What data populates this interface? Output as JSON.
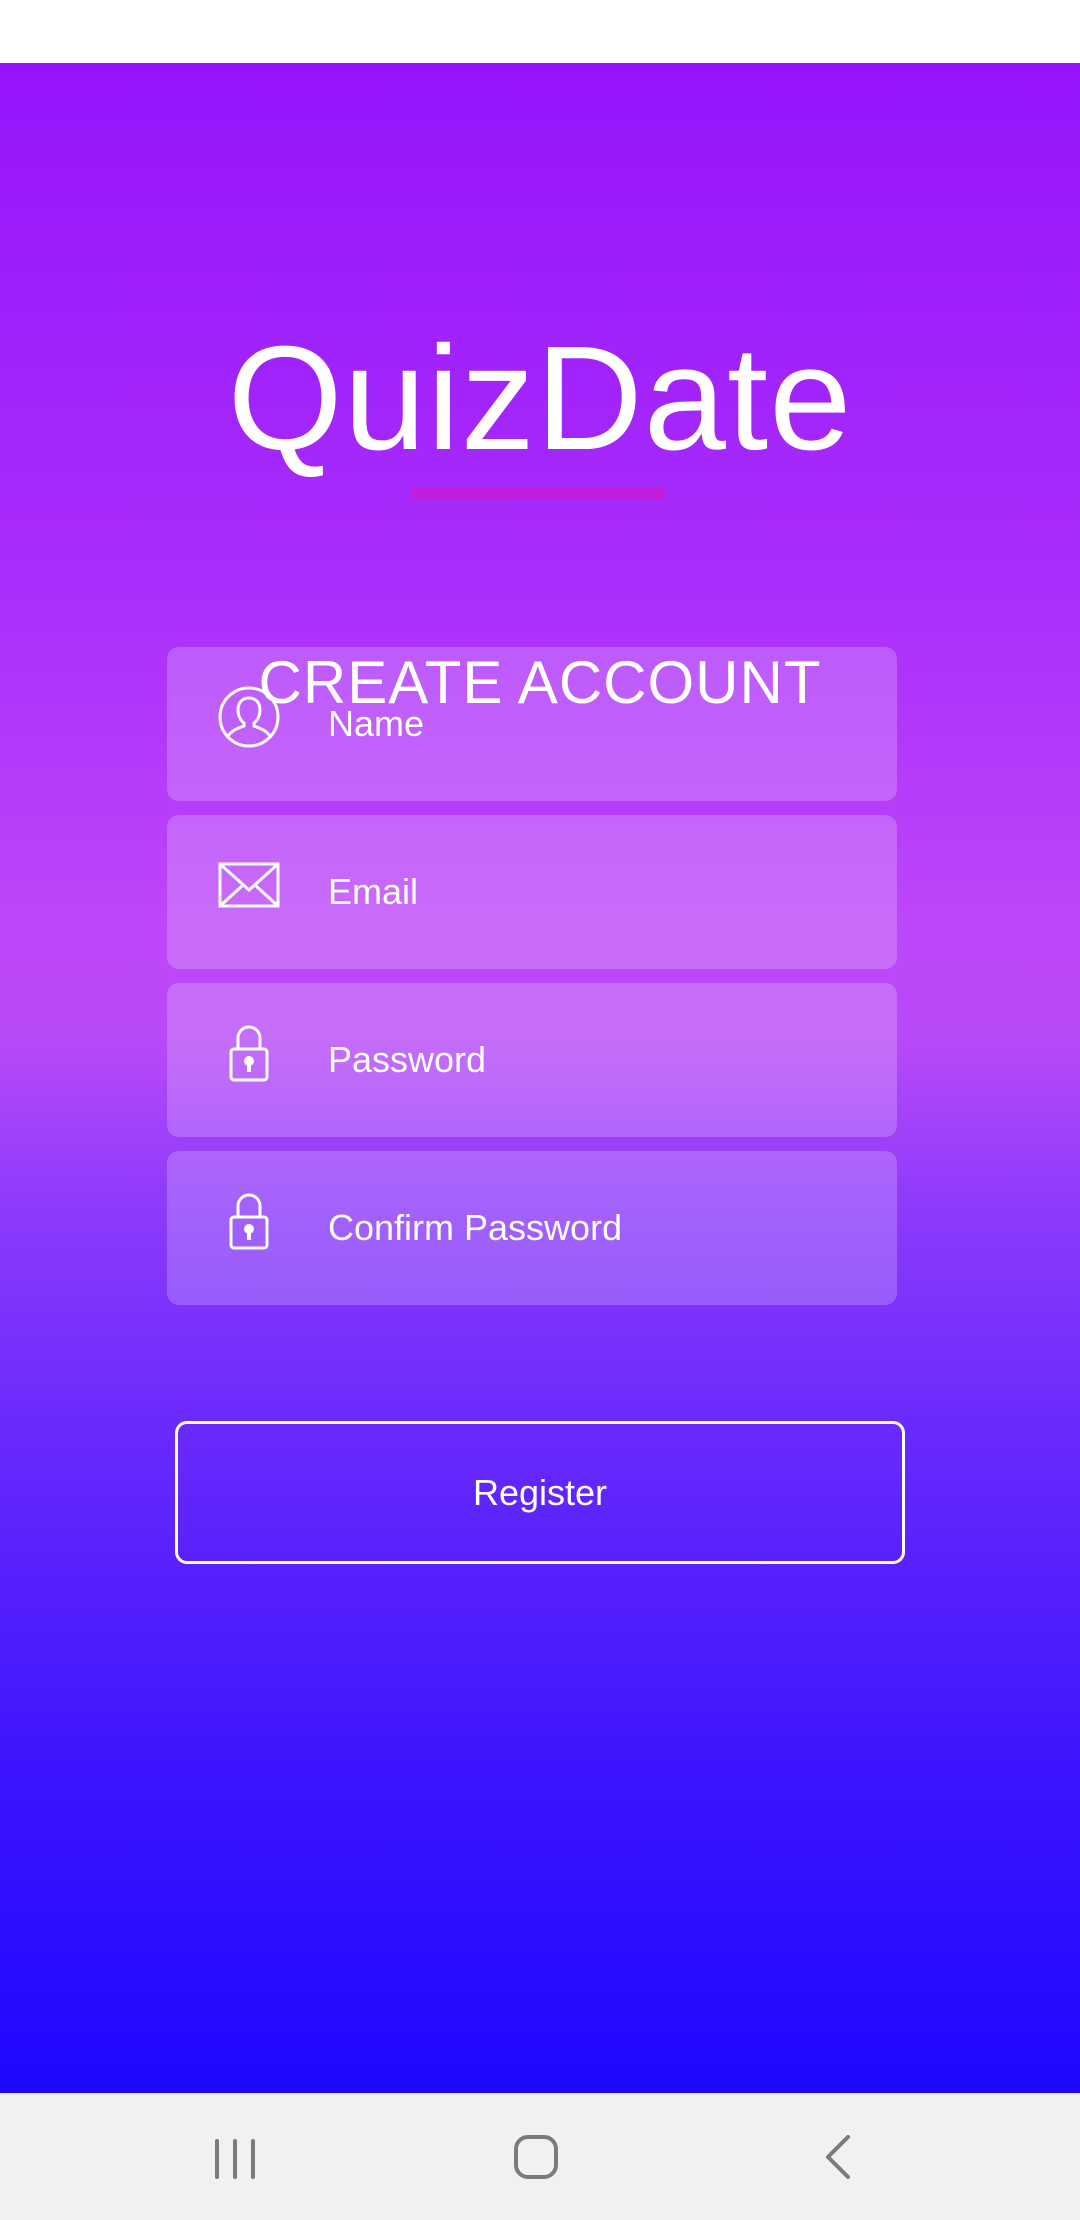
{
  "app": {
    "title": "QuizDate",
    "section_title": "CREATE ACCOUNT"
  },
  "form": {
    "fields": [
      {
        "placeholder": "Name",
        "icon": "user-icon"
      },
      {
        "placeholder": "Email",
        "icon": "envelope-icon"
      },
      {
        "placeholder": "Password",
        "icon": "lock-icon"
      },
      {
        "placeholder": "Confirm Password",
        "icon": "lock-icon"
      }
    ],
    "register_label": "Register"
  },
  "nav_bar": {
    "buttons": [
      "recent-apps-icon",
      "home-icon",
      "back-icon"
    ]
  },
  "colors": {
    "gradient_top": "#9514fc",
    "gradient_mid": "#bd47fa",
    "gradient_bottom": "#1d07fe",
    "underline": "#c21fdd",
    "text": "#ffffff"
  }
}
